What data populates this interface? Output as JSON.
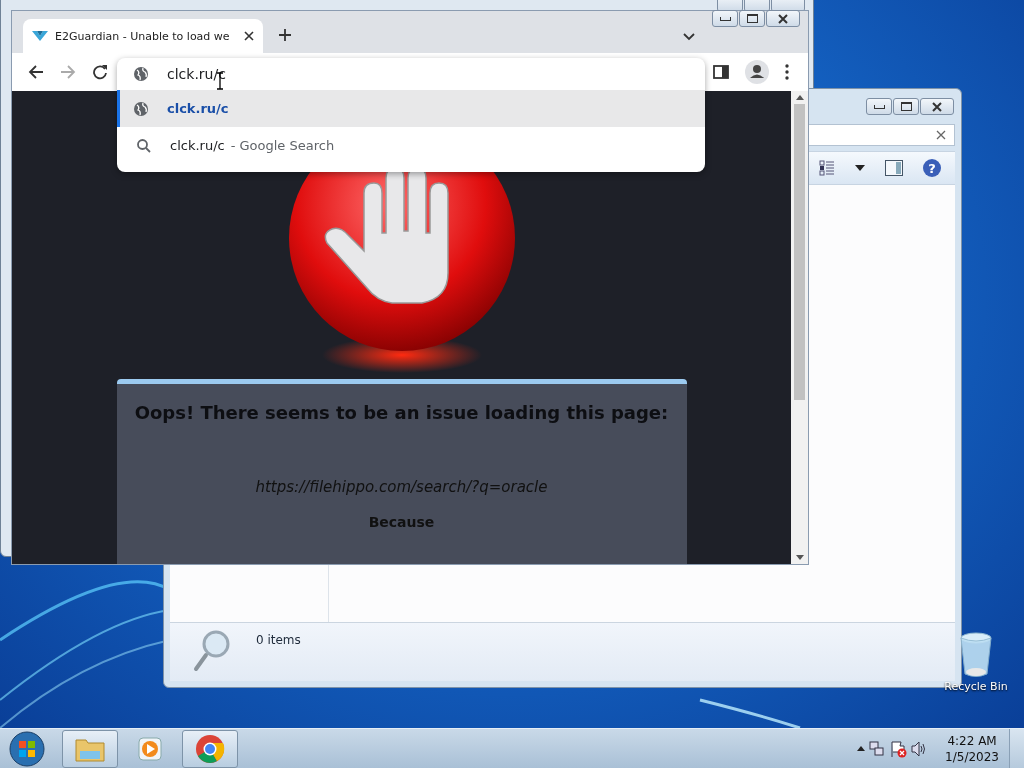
{
  "desktop": {
    "icons": [
      {
        "kind": "recycle-bin",
        "label": "Recycle Bin"
      }
    ]
  },
  "explorer_window": {
    "help_glyph": "?",
    "status_text": "0 items"
  },
  "browser": {
    "tabs": [
      {
        "title": "E2Guardian - Unable to load we",
        "selected": true
      }
    ],
    "omnibox": {
      "value": "clck.ru/c"
    },
    "suggestions": [
      {
        "kind": "url",
        "text": "clck.ru/c",
        "selected": true
      },
      {
        "kind": "search",
        "text": "clck.ru/c",
        "suffix": "- Google Search",
        "selected": false
      }
    ],
    "page": {
      "heading": "Oops! There seems to be an issue loading this page:",
      "url": "https://filehippo.com/search/?q=oracle",
      "reason_label": "Because"
    }
  },
  "taskbar": {
    "apps": [
      {
        "kind": "explorer",
        "pinned_open": true
      },
      {
        "kind": "media",
        "pinned_open": false
      },
      {
        "kind": "chrome",
        "pinned_open": true
      }
    ],
    "clock": {
      "time": "4:22 AM",
      "date": "1/5/2023"
    }
  }
}
